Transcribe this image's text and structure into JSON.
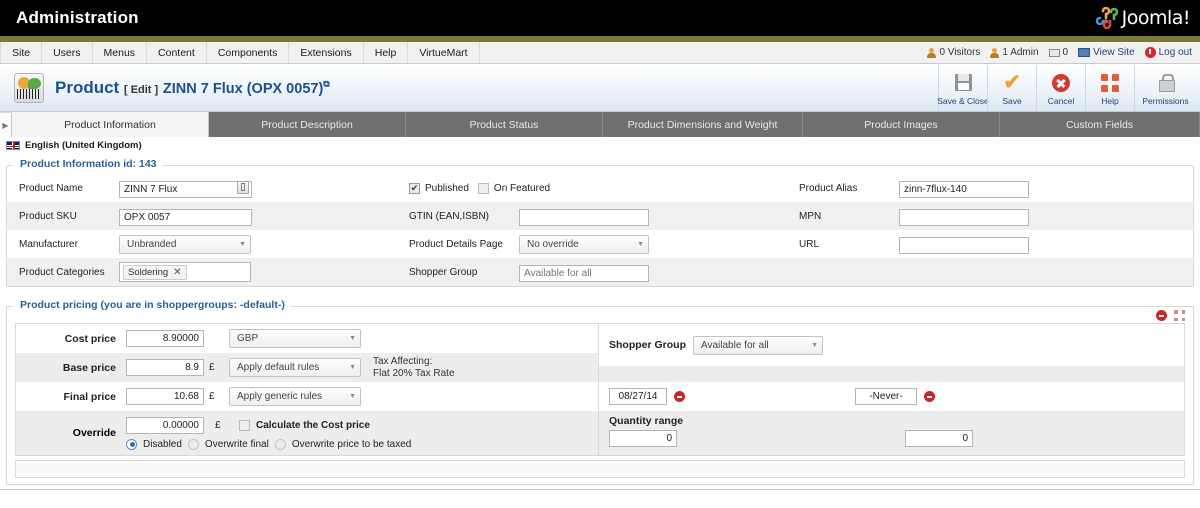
{
  "topbar": {
    "title": "Administration",
    "brand": "Joomla!"
  },
  "menu": {
    "items": [
      {
        "label": "Site"
      },
      {
        "label": "Users"
      },
      {
        "label": "Menus"
      },
      {
        "label": "Content"
      },
      {
        "label": "Components"
      },
      {
        "label": "Extensions"
      },
      {
        "label": "Help"
      },
      {
        "label": "VirtueMart"
      }
    ]
  },
  "status": {
    "visitors": "0 Visitors",
    "admins": "1 Admin",
    "messages": "0",
    "view_site": "View Site",
    "logout": "Log out"
  },
  "product_header": {
    "title": "Product",
    "edit_tag": "[ Edit ]",
    "name": "ZINN 7 Flux (OPX 0057)"
  },
  "toolbar": {
    "save_close": "Save & Close",
    "save": "Save",
    "cancel": "Cancel",
    "help": "Help",
    "permissions": "Permissions"
  },
  "tabs": [
    {
      "label": "Product Information",
      "active": true
    },
    {
      "label": "Product Description",
      "active": false
    },
    {
      "label": "Product Status",
      "active": false
    },
    {
      "label": "Product Dimensions and Weight",
      "active": false
    },
    {
      "label": "Product Images",
      "active": false
    },
    {
      "label": "Custom Fields",
      "active": false
    }
  ],
  "language": {
    "label": "English (United Kingdom)"
  },
  "info_section": {
    "legend": "Product Information id: 143",
    "col1": {
      "product_name_label": "Product Name",
      "product_name_value": "ZINN 7 Flux",
      "product_sku_label": "Product SKU",
      "product_sku_value": "OPX 0057",
      "manufacturer_label": "Manufacturer",
      "manufacturer_value": "Unbranded",
      "categories_label": "Product Categories",
      "categories_tag": "Soldering"
    },
    "col2": {
      "published_label": "Published",
      "featured_label": "On Featured",
      "gtin_label": "GTIN (EAN,ISBN)",
      "gtin_value": "",
      "details_page_label": "Product Details Page",
      "details_page_value": "No override",
      "shopper_group_label": "Shopper Group",
      "shopper_group_placeholder": "Available for all"
    },
    "col3": {
      "alias_label": "Product Alias",
      "alias_value": "zinn-7flux-140",
      "mpn_label": "MPN",
      "mpn_value": "",
      "url_label": "URL",
      "url_value": ""
    }
  },
  "pricing_section": {
    "legend": "Product pricing (you are in shoppergroups: -default-)",
    "cost_price_label": "Cost price",
    "cost_price_value": "8.90000",
    "cost_currency": "GBP",
    "base_price_label": "Base price",
    "base_price_value": "8.9",
    "base_currency_symbol": "£",
    "base_rule": "Apply default rules",
    "tax_affecting_line1": "Tax Affecting:",
    "tax_affecting_line2": "Flat 20% Tax Rate",
    "final_price_label": "Final price",
    "final_price_value": "10.68",
    "final_currency_symbol": "£",
    "final_rule": "Apply generic rules",
    "override_label": "Override",
    "override_value": "0.00000",
    "override_currency_symbol": "£",
    "calculate_cost_label": "Calculate the Cost price",
    "radio_disabled": "Disabled",
    "radio_overwrite_final": "Overwrite final",
    "radio_overwrite_taxed": "Overwrite price to be taxed",
    "shopper_group_label": "Shopper Group",
    "shopper_group_value": "Available for all",
    "date_from": "08/27/14",
    "date_to": "-Never-",
    "quantity_range_label": "Quantity range",
    "quantity_min": "0",
    "quantity_max": "0"
  },
  "colors": {
    "header_black": "#000000",
    "olive_stripe": "#7d7a33",
    "link_blue": "#1d4f91",
    "legend_blue": "#2b6096",
    "tab_bar_gray": "#6f6f6f",
    "danger_red": "#c8262a"
  }
}
